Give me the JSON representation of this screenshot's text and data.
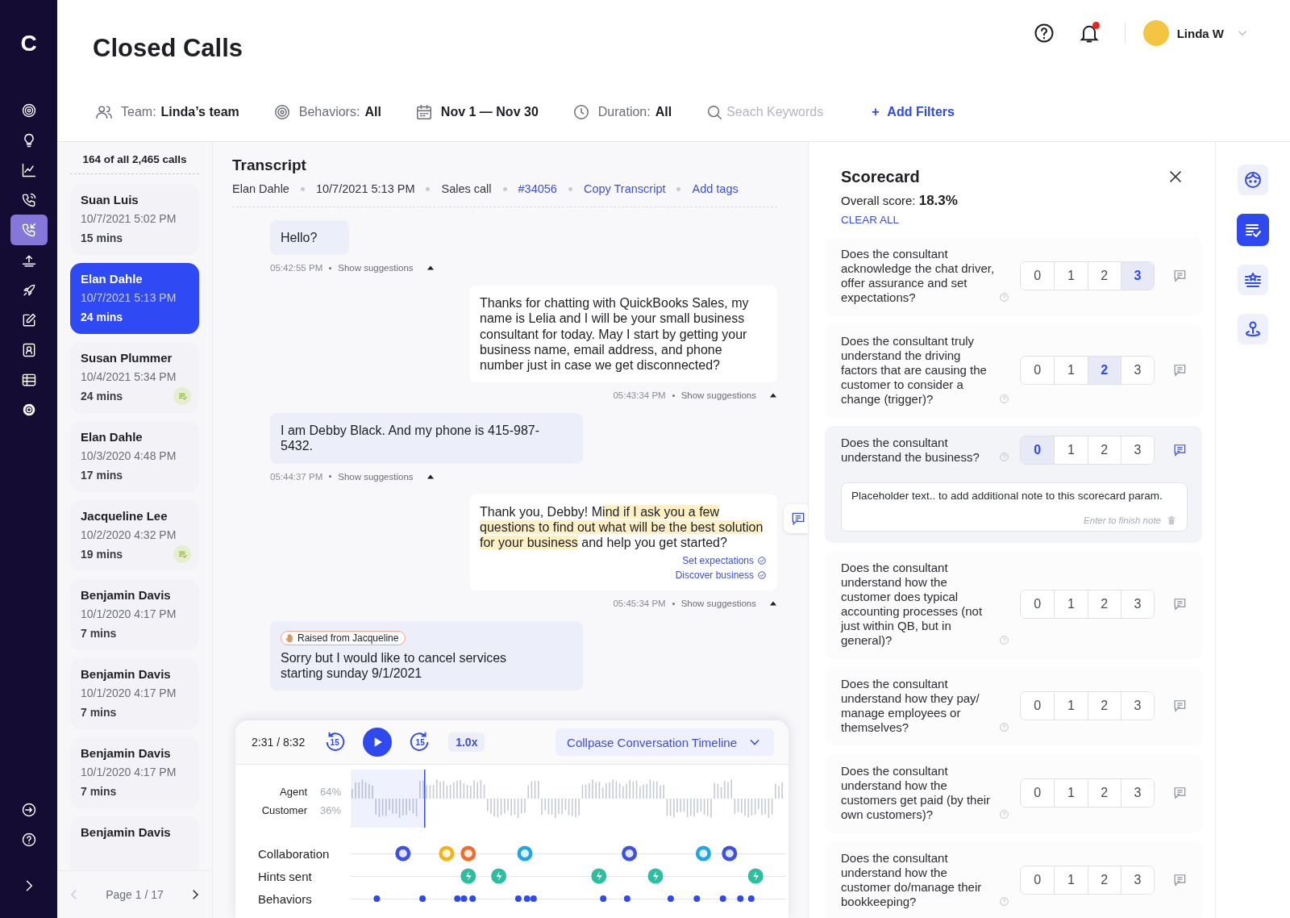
{
  "nav": {
    "logo": "C",
    "items": [
      {
        "kind": "target",
        "selected": false
      },
      {
        "kind": "bulb",
        "selected": false
      },
      {
        "kind": "chart",
        "selected": false
      },
      {
        "kind": "phone-call",
        "selected": false
      },
      {
        "kind": "phone-incoming",
        "selected": true
      },
      {
        "kind": "upload",
        "selected": false
      },
      {
        "kind": "rocket",
        "selected": false
      },
      {
        "kind": "edit",
        "selected": false
      },
      {
        "kind": "contact",
        "selected": false
      },
      {
        "kind": "table",
        "selected": false
      },
      {
        "kind": "settings",
        "selected": false
      }
    ],
    "bottom_items": [
      {
        "kind": "sign-in"
      },
      {
        "kind": "help"
      },
      {
        "kind": "chevron"
      }
    ]
  },
  "header": {
    "title": "Closed Calls",
    "notifications_unread": true,
    "user": {
      "name": "Linda W"
    }
  },
  "filters": [
    {
      "kind": "team",
      "label": "Team:",
      "value": "Linda’s team"
    },
    {
      "kind": "behaviors",
      "label": "Behaviors:",
      "value": "All"
    },
    {
      "kind": "date",
      "value": "Nov 1 — Nov 30"
    },
    {
      "kind": "duration",
      "label": "Duration:",
      "value": "All"
    }
  ],
  "search": {
    "placeholder": "Seach Keywords"
  },
  "add_filters": {
    "icon": "+",
    "label": "Add Filters"
  },
  "calls": {
    "summary": "164 of all 2,465 calls",
    "items": [
      {
        "name": "Suan Luis",
        "datetime": "10/7/2021 5:02 PM",
        "duration": "15 mins",
        "selected": false,
        "reviewed": false
      },
      {
        "name": "Elan Dahle",
        "datetime": "10/7/2021 5:13 PM",
        "duration": "24 mins",
        "selected": true,
        "reviewed": false
      },
      {
        "name": "Susan Plummer",
        "datetime": "10/4/2021 5:34 PM",
        "duration": "24 mins",
        "selected": false,
        "reviewed": true
      },
      {
        "name": "Elan Dahle",
        "datetime": "10/3/2020 4:48 PM",
        "duration": "17 mins",
        "selected": false,
        "reviewed": false
      },
      {
        "name": "Jacqueline Lee",
        "datetime": "10/2/2020 4:32 PM",
        "duration": "19 mins",
        "selected": false,
        "reviewed": true
      },
      {
        "name": "Benjamin Davis",
        "datetime": "10/1/2020 4:17 PM",
        "duration": "7 mins",
        "selected": false,
        "reviewed": false
      },
      {
        "name": "Benjamin Davis",
        "datetime": "10/1/2020 4:17 PM",
        "duration": "7 mins",
        "selected": false,
        "reviewed": false
      },
      {
        "name": "Benjamin Davis",
        "datetime": "10/1/2020 4:17 PM",
        "duration": "7 mins",
        "selected": false,
        "reviewed": false
      },
      {
        "name": "Benjamin Davis",
        "selected": false,
        "reviewed": false
      }
    ],
    "pager": {
      "label": "Page 1 / 17",
      "prev_disabled": true,
      "next_disabled": false
    }
  },
  "transcript": {
    "title": "Transcript",
    "meta": [
      {
        "kind": "text",
        "text": "Elan Dahle"
      },
      {
        "kind": "text",
        "text": "10/7/2021 5:13 PM"
      },
      {
        "kind": "text",
        "text": "Sales call"
      },
      {
        "kind": "link",
        "text": "#34056"
      },
      {
        "kind": "link",
        "text": "Copy Transcript"
      },
      {
        "kind": "link",
        "text": "Add tags"
      }
    ],
    "messages": [
      {
        "kind": "customer",
        "parts": [
          {
            "text": "Hello?",
            "highlight": false
          }
        ],
        "time": "05:42:55 PM",
        "suggestions": "Show suggestions",
        "expanded": true
      },
      {
        "kind": "agent",
        "parts": [
          {
            "text": "Thanks for chatting with QuickBooks Sales, my name is Lelia and I will be your small business consultant for today. May I start by getting your business name, email address, and phone number just in case we get disconnected?",
            "highlight": false
          }
        ],
        "time": "05:43:34 PM",
        "suggestions": "Show suggestions",
        "expanded": true
      },
      {
        "kind": "customer",
        "parts": [
          {
            "text": "I am Debby Black. And my phone is 415-987-5432.",
            "highlight": false
          }
        ],
        "time": "05:44:37 PM",
        "suggestions": "Show suggestions",
        "expanded": true
      },
      {
        "kind": "agent",
        "parts": [
          {
            "text": "Thank you, Debby! M",
            "highlight": false
          },
          {
            "text": "ind if I ask you a few questions to find out what will be the best solution for your business",
            "highlight": true
          },
          {
            "text": " and help you get started?",
            "highlight": false
          }
        ],
        "tags": [
          "Set expectations",
          "Discover business"
        ],
        "note_button": true,
        "time": "05:45:34 PM",
        "suggestions": "Show suggestions",
        "expanded": true
      },
      {
        "kind": "customer",
        "badge": "Raised from Jacqueline",
        "parts": [
          {
            "text": "Sorry but I would like to cancel services starting sunday 9/1/2021",
            "highlight": false
          }
        ]
      }
    ]
  },
  "player": {
    "time": "2:31 / 8:32",
    "skip_back": "15",
    "skip_forward": "15",
    "speed": "1.0x",
    "collapse": "Collpase Conversation Timeline",
    "level": 0.17,
    "speakers": [
      {
        "name": "Agent",
        "share": "64%"
      },
      {
        "name": "Customer",
        "share": "36%"
      }
    ],
    "rows": [
      {
        "kind": "collaboration",
        "label": "Collaboration"
      },
      {
        "kind": "hints",
        "label": "Hints sent"
      },
      {
        "kind": "behaviors",
        "label": "Behaviors"
      }
    ]
  },
  "scorecard": {
    "title": "Scorecard",
    "overall_label": "Overall score:",
    "overall_value": "18.3%",
    "clear_all": "CLEAR ALL",
    "questions": [
      {
        "text": "Does the consultant acknowledge the chat driver, offer assurance and set expectations?",
        "note_open": false,
        "options": [
          {
            "label": "0",
            "selected": false
          },
          {
            "label": "1",
            "selected": false
          },
          {
            "label": "2",
            "selected": false
          },
          {
            "label": "3",
            "selected": true
          }
        ]
      },
      {
        "text": "Does the consultant truly understand the driving factors that are causing the customer to consider a change (trigger)?",
        "note_open": false,
        "options": [
          {
            "label": "0",
            "selected": false
          },
          {
            "label": "1",
            "selected": false
          },
          {
            "label": "2",
            "selected": true
          },
          {
            "label": "3",
            "selected": false
          }
        ]
      },
      {
        "text": "Does the consultant understand the business?",
        "note_open": true,
        "note": {
          "value": "Placeholder text.. to add additional note to this scorecard param.",
          "hint": "Enter to finish note"
        },
        "options": [
          {
            "label": "0",
            "selected": true
          },
          {
            "label": "1",
            "selected": false
          },
          {
            "label": "2",
            "selected": false
          },
          {
            "label": "3",
            "selected": false
          }
        ]
      },
      {
        "text": "Does the consultant understand how the customer does typical accounting processes (not just within QB, but in general)?",
        "note_open": false,
        "options": [
          {
            "label": "0",
            "selected": false
          },
          {
            "label": "1",
            "selected": false
          },
          {
            "label": "2",
            "selected": false
          },
          {
            "label": "3",
            "selected": false
          }
        ]
      },
      {
        "text": "Does the consultant understand how they pay/ manage employees or themselves?",
        "note_open": false,
        "options": [
          {
            "label": "0",
            "selected": false
          },
          {
            "label": "1",
            "selected": false
          },
          {
            "label": "2",
            "selected": false
          },
          {
            "label": "3",
            "selected": false
          }
        ]
      },
      {
        "text": "Does the consultant understand how the customers get paid (by their own customers)?",
        "note_open": false,
        "options": [
          {
            "label": "0",
            "selected": false
          },
          {
            "label": "1",
            "selected": false
          },
          {
            "label": "2",
            "selected": false
          },
          {
            "label": "3",
            "selected": false
          }
        ]
      },
      {
        "text": "Does the consultant understand how the customer do/manage their bookkeeping?",
        "note_open": false,
        "options": [
          {
            "label": "0",
            "selected": false
          },
          {
            "label": "1",
            "selected": false
          },
          {
            "label": "2",
            "selected": false
          },
          {
            "label": "3",
            "selected": false
          }
        ]
      }
    ]
  },
  "right_rail": [
    {
      "kind": "face",
      "selected": false
    },
    {
      "kind": "checklist",
      "selected": true
    },
    {
      "kind": "star-list",
      "selected": false
    },
    {
      "kind": "pin",
      "selected": false
    }
  ]
}
